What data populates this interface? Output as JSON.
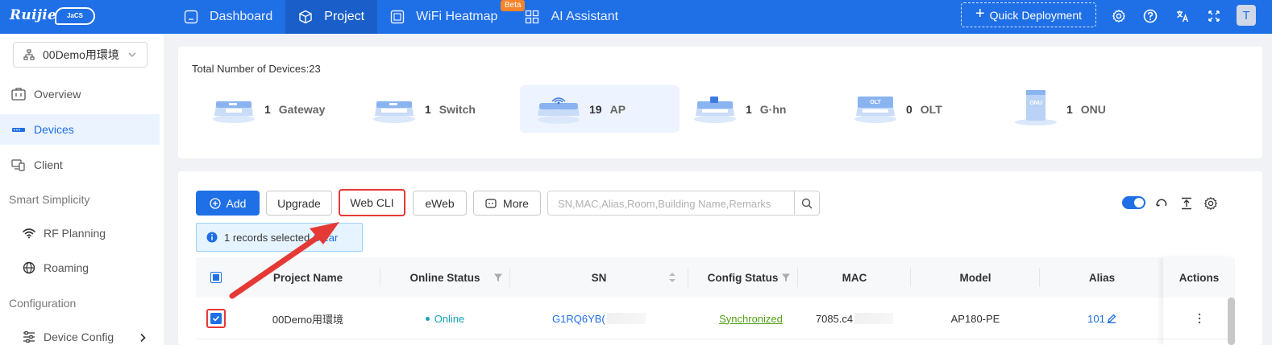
{
  "topbar": {
    "logo": "Ruijie",
    "logo_badge": "JaCS",
    "nav": [
      {
        "label": "Dashboard",
        "icon": "dashboard-icon"
      },
      {
        "label": "Project",
        "icon": "cube-icon"
      },
      {
        "label": "WiFi Heatmap",
        "icon": "heatmap-icon",
        "badge": "Beta"
      },
      {
        "label": "AI Assistant",
        "icon": "grid-icon"
      }
    ],
    "quick_deployment": "Quick Deployment",
    "avatar": "T"
  },
  "sidebar": {
    "project": "00Demo用環境",
    "items": {
      "overview": "Overview",
      "devices": "Devices",
      "client": "Client",
      "group_smart": "Smart Simplicity",
      "rf_planning": "RF Planning",
      "roaming": "Roaming",
      "group_config": "Configuration",
      "device_config": "Device Config"
    }
  },
  "summary": {
    "total": "Total Number of Devices:23",
    "cards": [
      {
        "count": "1",
        "label": "Gateway"
      },
      {
        "count": "1",
        "label": "Switch"
      },
      {
        "count": "19",
        "label": "AP"
      },
      {
        "count": "1",
        "label": "G·hn"
      },
      {
        "count": "0",
        "label": "OLT"
      },
      {
        "count": "1",
        "label": "ONU"
      }
    ],
    "olt_text": "OLT",
    "onu_text": "ONU"
  },
  "toolbar": {
    "add": "Add",
    "upgrade": "Upgrade",
    "webcli": "Web CLI",
    "eweb": "eWeb",
    "more": "More",
    "search_placeholder": "SN,MAC,Alias,Room,Building Name,Remarks"
  },
  "selection": {
    "text": "1 records selected",
    "clear": "Clear"
  },
  "table": {
    "headers": {
      "project_name": "Project Name",
      "online_status": "Online Status",
      "sn": "SN",
      "config_status": "Config Status",
      "mac": "MAC",
      "model": "Model",
      "alias": "Alias",
      "actions": "Actions"
    },
    "row": {
      "project_name": "00Demo用環境",
      "online_status": "Online",
      "sn": "G1RQ6YB(",
      "config_status": "Synchronized",
      "mac": "7085.c4",
      "model": "AP180-PE",
      "alias": "101"
    }
  },
  "colors": {
    "primary": "#1f6fe6",
    "highlight": "#e53935",
    "online": "#17a2b8",
    "synced": "#52a11a",
    "beta": "#f5842a"
  }
}
